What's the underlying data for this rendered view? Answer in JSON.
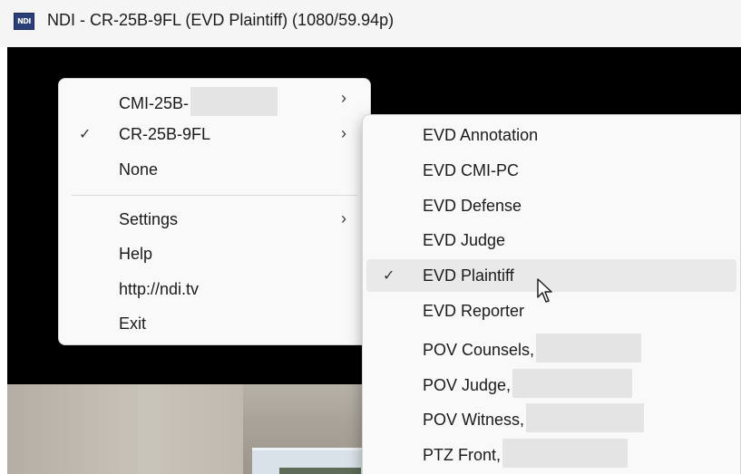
{
  "window": {
    "icon_label": "NDI",
    "title": "NDI - CR-25B-9FL (EVD Plaintiff) (1080/59.94p)"
  },
  "main_menu": {
    "items": [
      {
        "label": "CMI-25B-",
        "checked": false,
        "submenu": true
      },
      {
        "label": "CR-25B-9FL",
        "checked": true,
        "submenu": true
      },
      {
        "label": "None",
        "checked": false,
        "submenu": false
      },
      {
        "label": "Settings",
        "checked": false,
        "submenu": true
      },
      {
        "label": "Help",
        "checked": false,
        "submenu": false
      },
      {
        "label": "http://ndi.tv",
        "checked": false,
        "submenu": false
      },
      {
        "label": "Exit",
        "checked": false,
        "submenu": false
      }
    ]
  },
  "sub_menu": {
    "items": [
      {
        "label": "EVD Annotation",
        "checked": false
      },
      {
        "label": "EVD CMI-PC",
        "checked": false
      },
      {
        "label": "EVD Defense",
        "checked": false
      },
      {
        "label": "EVD Judge",
        "checked": false
      },
      {
        "label": "EVD Plaintiff",
        "checked": true,
        "hovered": true
      },
      {
        "label": "EVD Reporter",
        "checked": false
      },
      {
        "label": "POV Counsels,",
        "checked": false
      },
      {
        "label": "POV Judge,",
        "checked": false
      },
      {
        "label": "POV Witness,",
        "checked": false
      },
      {
        "label": "PTZ Front,",
        "checked": false
      }
    ]
  },
  "glyphs": {
    "check": "✓",
    "chevron": "›"
  }
}
